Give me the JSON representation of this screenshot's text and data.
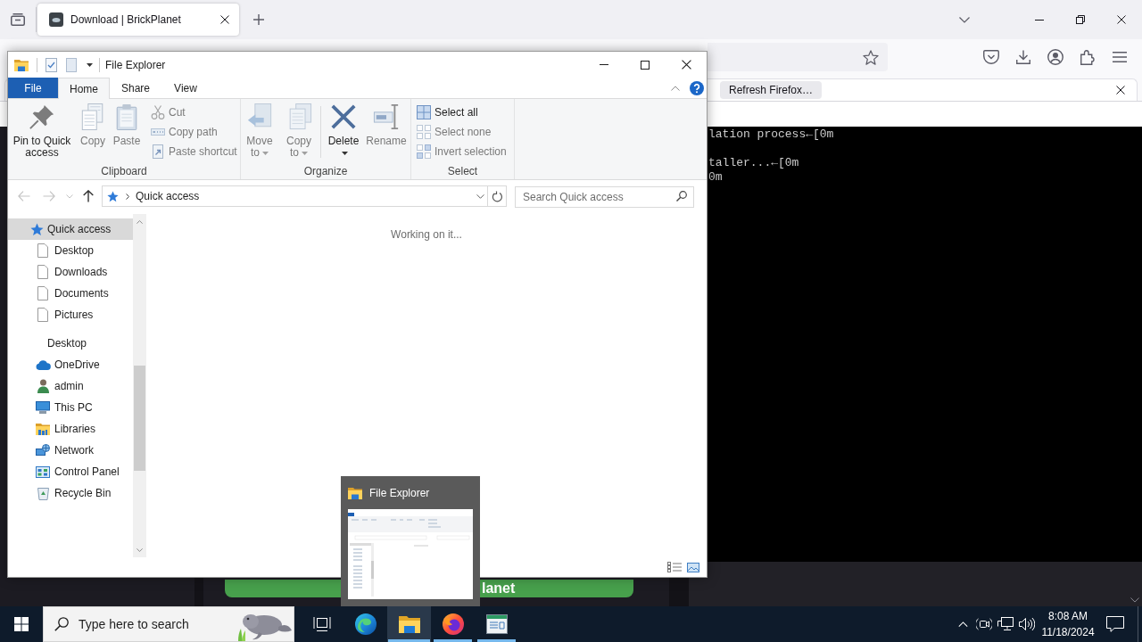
{
  "browser": {
    "tabs": [
      {
        "title": "Download | BrickPlanet",
        "selected": true
      }
    ],
    "notification": {
      "button": "Refresh Firefox…"
    },
    "terminal": {
      "blocks": [
        [
          "lation process←[0m"
        ],
        [
          "taller...←[0m",
          "0m"
        ]
      ]
    },
    "page_button": "lanet"
  },
  "explorer": {
    "title": "File Explorer",
    "ribbon_tabs": [
      {
        "label": "File",
        "kind": "menu",
        "selected": false
      },
      {
        "label": "Home",
        "kind": "tab",
        "selected": true
      },
      {
        "label": "Share",
        "kind": "tab",
        "selected": false
      },
      {
        "label": "View",
        "kind": "tab",
        "selected": false
      }
    ],
    "ribbon_groups": [
      {
        "label": "Clipboard",
        "sections": [
          [
            {
              "label": "Pin to Quick access",
              "kind": "pin",
              "disabled": false,
              "dropdown": false
            },
            {
              "label": "Copy",
              "kind": "copy",
              "disabled": true,
              "dropdown": false
            },
            {
              "label": "Paste",
              "kind": "paste",
              "disabled": true,
              "dropdown": false
            },
            {
              "label": "Cut",
              "kind": "cut",
              "disabled": true,
              "dropdown": false
            },
            {
              "label": "Copy path",
              "kind": "copy-path",
              "disabled": true,
              "dropdown": false
            },
            {
              "label": "Paste shortcut",
              "kind": "paste-shortcut",
              "disabled": true,
              "dropdown": false
            }
          ]
        ]
      },
      {
        "label": "Organize",
        "sections": [
          [
            {
              "label": "Move to",
              "kind": "move-to",
              "disabled": true,
              "dropdown": true
            },
            {
              "label": "Copy to",
              "kind": "copy-to",
              "disabled": true,
              "dropdown": true
            }
          ],
          [
            {
              "label": "Delete",
              "kind": "delete",
              "disabled": false,
              "dropdown": true
            },
            {
              "label": "Rename",
              "kind": "rename",
              "disabled": true,
              "dropdown": false
            }
          ]
        ]
      },
      {
        "label": "Select",
        "sections": [
          [
            {
              "label": "Select all",
              "kind": "select-all",
              "disabled": false,
              "dropdown": false
            },
            {
              "label": "Select none",
              "kind": "select-none",
              "disabled": true,
              "dropdown": false
            },
            {
              "label": "Invert selection",
              "kind": "invert-selection",
              "disabled": true,
              "dropdown": false
            }
          ]
        ]
      }
    ],
    "nav_buttons": [
      {
        "kind": "back",
        "disabled": true
      },
      {
        "kind": "forward",
        "disabled": true
      },
      {
        "kind": "recent",
        "disabled": true
      },
      {
        "kind": "up",
        "disabled": false
      }
    ],
    "address": {
      "segments": [
        "Quick access"
      ]
    },
    "search": {
      "placeholder": "Search Quick access"
    },
    "nav_pane": [
      {
        "label": "Quick access",
        "kind": "quick-access",
        "selected": true,
        "children": [
          {
            "label": "Desktop",
            "kind": "page",
            "selected": false
          },
          {
            "label": "Downloads",
            "kind": "page",
            "selected": false
          },
          {
            "label": "Documents",
            "kind": "page",
            "selected": false
          },
          {
            "label": "Pictures",
            "kind": "page",
            "selected": false
          }
        ]
      },
      {
        "label": "Desktop",
        "kind": "plain",
        "selected": false,
        "children": [
          {
            "label": "OneDrive",
            "kind": "cloud",
            "selected": false
          },
          {
            "label": "admin",
            "kind": "user",
            "selected": false
          },
          {
            "label": "This PC",
            "kind": "pc",
            "selected": false
          },
          {
            "label": "Libraries",
            "kind": "libraries",
            "selected": false
          },
          {
            "label": "Network",
            "kind": "network",
            "selected": false
          },
          {
            "label": "Control Panel",
            "kind": "control-panel",
            "selected": false
          },
          {
            "label": "Recycle Bin",
            "kind": "recycle-bin",
            "selected": false
          }
        ]
      }
    ],
    "status_message": "Working on it..."
  },
  "taskbar_preview": {
    "title": "File Explorer"
  },
  "taskbar": {
    "search": {
      "placeholder": "Type here to search"
    },
    "apps": [
      {
        "kind": "task-view",
        "running": false,
        "selected": false
      },
      {
        "kind": "edge",
        "running": false,
        "selected": false
      },
      {
        "kind": "explorer",
        "running": true,
        "selected": true
      },
      {
        "kind": "firefox",
        "running": true,
        "selected": false
      },
      {
        "kind": "app",
        "running": true,
        "selected": false
      }
    ],
    "clock": {
      "time": "8:08 AM",
      "date": "11/18/2024"
    }
  }
}
